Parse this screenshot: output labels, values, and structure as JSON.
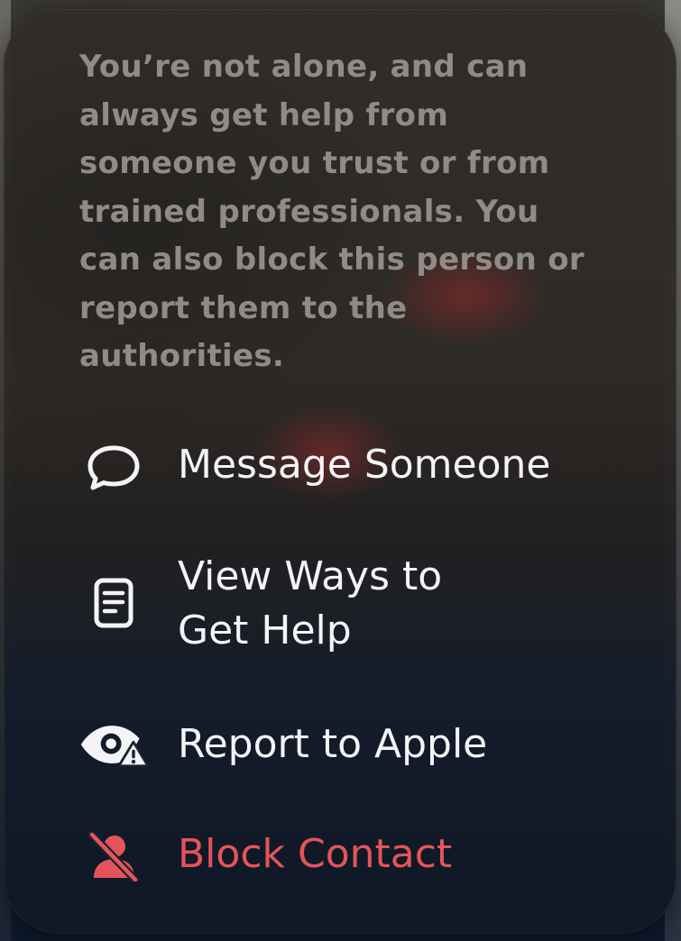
{
  "intro_text": "You’re not alone, and can always get help from someone you trust or from trained professionals. You can also block this person or report them to the authorities.",
  "menu": {
    "items": [
      {
        "label": "Message Someone",
        "icon": "speech-bubble-icon"
      },
      {
        "label": "View Ways to\nGet Help",
        "icon": "document-icon"
      },
      {
        "label": "Report to Apple",
        "icon": "eye-warning-icon"
      },
      {
        "label": "Block Contact",
        "icon": "person-slash-icon"
      }
    ]
  },
  "colors": {
    "primary_text": "#f4f4f6",
    "secondary_text": "#8f8c88",
    "destructive": "#e5545a"
  }
}
